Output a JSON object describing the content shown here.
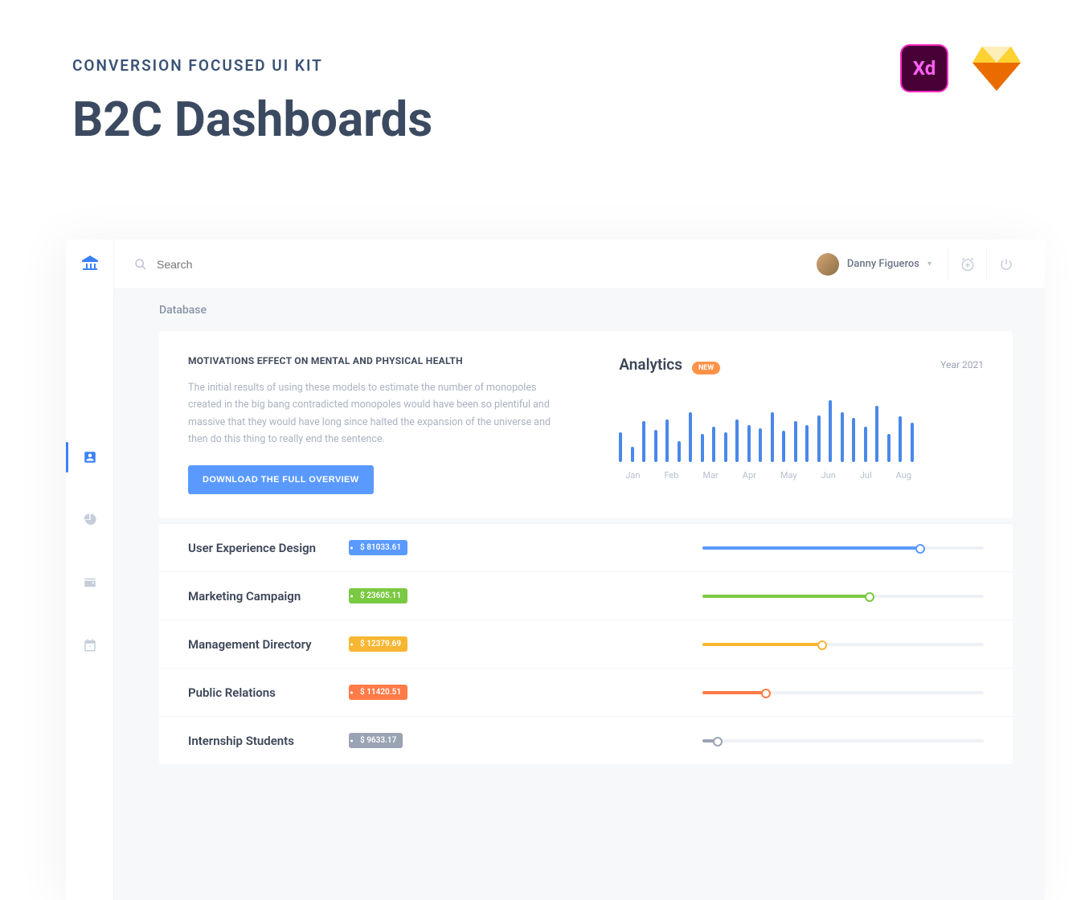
{
  "header": {
    "subhead": "CONVERSION FOCUSED UI KIT",
    "title": "B2C Dashboards"
  },
  "topbar": {
    "search_placeholder": "Search",
    "user_name": "Danny Figueros"
  },
  "breadcrumb": "Database",
  "panel": {
    "title": "MOTIVATIONS EFFECT ON MENTAL AND PHYSICAL HEALTH",
    "desc": "The initial results of using these models to estimate the number of monopoles created in the big bang contradicted monopoles would have been so plentiful and massive that they would have long since halted the expansion of the universe and then do this thing to really end the sentence.",
    "button": "DOWNLOAD THE FULL OVERVIEW",
    "analytics_title": "Analytics",
    "new_label": "NEW",
    "year_label": "Year 2021"
  },
  "chart_data": {
    "type": "bar",
    "months": [
      "Jan",
      "Feb",
      "Mar",
      "Apr",
      "May",
      "Jun",
      "Jul",
      "Aug"
    ],
    "values": [
      42,
      22,
      58,
      46,
      60,
      30,
      70,
      40,
      50,
      42,
      60,
      52,
      48,
      70,
      44,
      58,
      52,
      66,
      88,
      70,
      62,
      50,
      80,
      40,
      65,
      56
    ],
    "xlabel": "",
    "ylabel": "",
    "ylim": [
      0,
      100
    ]
  },
  "rows": [
    {
      "label": "User Experience Design",
      "amount": "$ 81033.61",
      "color": "#5a9aff",
      "percent": 78
    },
    {
      "label": "Marketing Campaign",
      "amount": "$ 23605.11",
      "color": "#7ac943",
      "percent": 60
    },
    {
      "label": "Management Directory",
      "amount": "$ 12379.69",
      "color": "#f7b733",
      "percent": 43
    },
    {
      "label": "Public Relations",
      "amount": "$ 11420.51",
      "color": "#ff7b47",
      "percent": 23
    },
    {
      "label": "Internship Students",
      "amount": "$ 9633.17",
      "color": "#9aa3b3",
      "percent": 6
    }
  ]
}
